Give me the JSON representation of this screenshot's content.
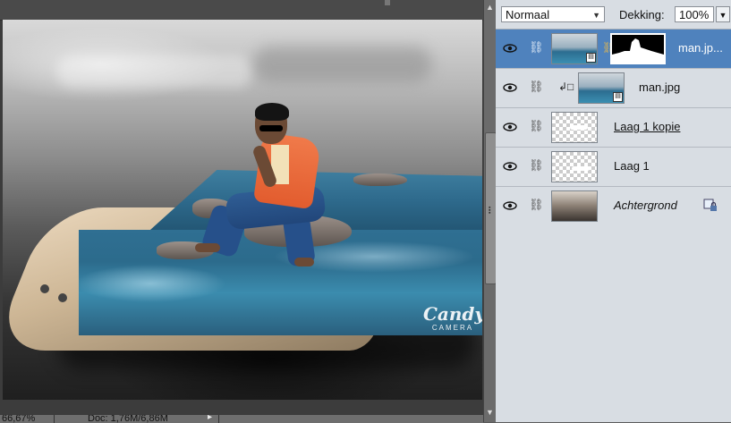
{
  "canvas": {
    "watermark": {
      "line1": "Candy",
      "line2": "CAMERA"
    },
    "status": {
      "zoom": "66,67%",
      "doc_info": "Doc: 1,76M/6,86M",
      "arrow": "▸"
    }
  },
  "layers_panel": {
    "blend_mode": "Normaal",
    "opacity_label": "Dekking:",
    "opacity_value": "100%",
    "layers": [
      {
        "name": "man.jp...",
        "selected": true,
        "visible": true,
        "has_mask": true
      },
      {
        "name": "man.jpg",
        "selected": false,
        "visible": true,
        "clipped": true
      },
      {
        "name": "Laag 1 kopie",
        "selected": false,
        "visible": true
      },
      {
        "name": "Laag 1",
        "selected": false,
        "visible": true
      },
      {
        "name": "Achtergrond",
        "selected": false,
        "visible": true,
        "locked": true
      }
    ]
  },
  "colors": {
    "selected_row": "#4f82bd",
    "panel_bg": "#d8dde3",
    "canvas_bg": "#3c3c3c"
  },
  "icons": [
    "eye-icon",
    "link-icon",
    "chevron-down-icon",
    "lock-icon",
    "clip-arrow-icon"
  ]
}
